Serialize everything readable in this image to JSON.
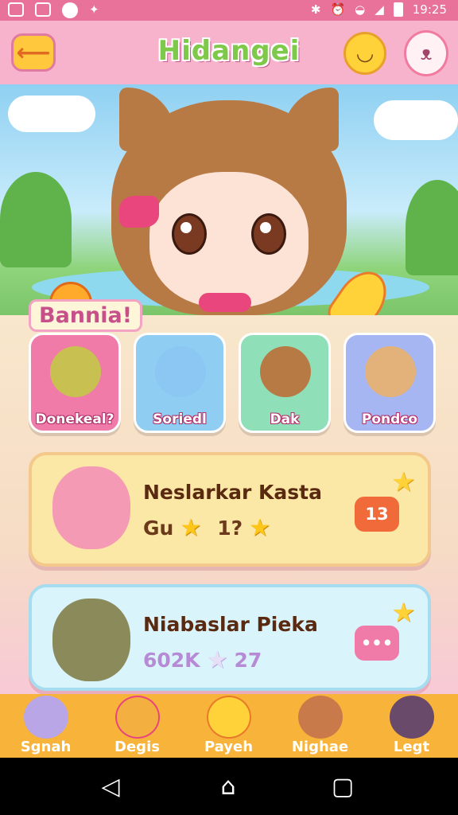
{
  "status_bar": {
    "time": "19:25"
  },
  "header": {
    "title": "Hidangei",
    "back_icon": "back-arrow-icon",
    "left_emoji_icon": "smiley-icon",
    "right_emoji_icon": "bunny-face-icon"
  },
  "section": {
    "label": "Bannia!"
  },
  "characters": [
    {
      "label": "Donekeal?",
      "bg": "#f07aa8",
      "avatar": "#c8c050"
    },
    {
      "label": "Soriedl",
      "bg": "#8fcdf2",
      "avatar": "#8cc6f2"
    },
    {
      "label": "Dak",
      "bg": "#8fe0b8",
      "avatar": "#b87a45"
    },
    {
      "label": "Pondco",
      "bg": "#a6b6f2",
      "avatar": "#e2b27a"
    }
  ],
  "cards": [
    {
      "name": "Neslarkar Kasta",
      "meta_left": "Gu",
      "meta_right": "1?",
      "badge": "13",
      "bg": "#fbe7a6",
      "border": "#f3c88a",
      "avatar": "#f59ab4",
      "badge_color": "#f06a3a"
    },
    {
      "name": "Niabaslar Pieka",
      "meta_left": "602K",
      "meta_right": "27",
      "badge": "•••",
      "bg": "#d9f4fb",
      "border": "#a6dcf0",
      "avatar": "#8a8a5a",
      "badge_color": "#f07aa8"
    }
  ],
  "bottom_nav": [
    {
      "label": "Sgnah",
      "avatar": "#b9a6e6"
    },
    {
      "label": "Degis",
      "avatar": "#f3b040"
    },
    {
      "label": "Payeh",
      "avatar": "#ffd23a"
    },
    {
      "label": "Nighae",
      "avatar": "#c87a4a"
    },
    {
      "label": "Legt",
      "avatar": "#6a4a6a"
    }
  ]
}
